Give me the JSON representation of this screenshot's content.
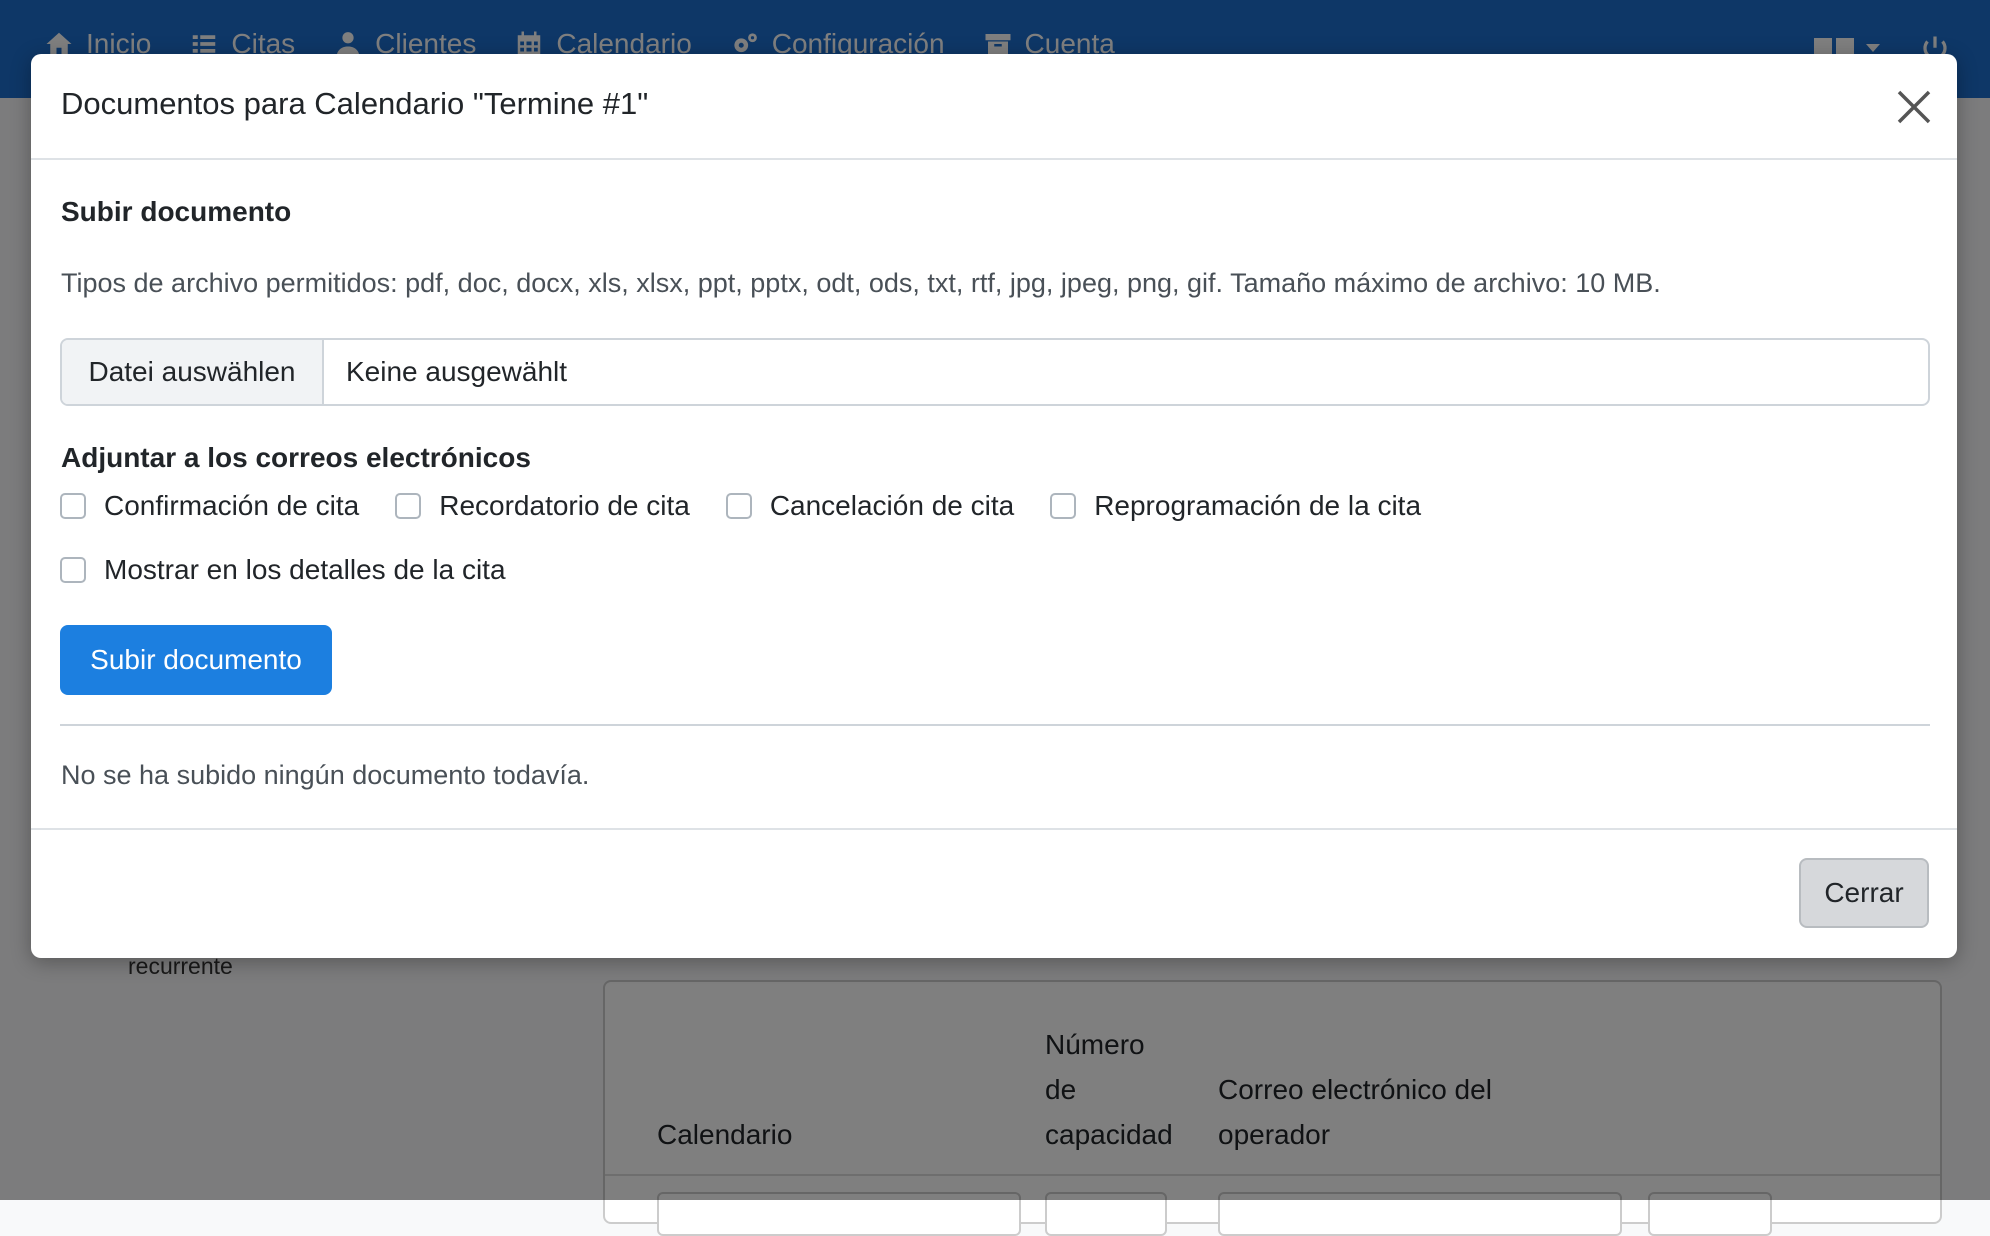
{
  "nav": {
    "items": [
      {
        "label": "Inicio",
        "icon": "home-icon"
      },
      {
        "label": "Citas",
        "icon": "list-icon"
      },
      {
        "label": "Clientes",
        "icon": "user-icon"
      },
      {
        "label": "Calendario",
        "icon": "calendar-icon"
      },
      {
        "label": "Configuración",
        "icon": "cogs-icon"
      },
      {
        "label": "Cuenta",
        "icon": "archive-icon"
      }
    ],
    "color": "#1c6fcf"
  },
  "background": {
    "sidebar_text": "recurrente",
    "table_headers": {
      "calendar": "Calendario",
      "capacity_1": "Número",
      "capacity_2": "de",
      "capacity_3": "capacidad",
      "operator_1": "Correo electrónico del",
      "operator_2": "operador"
    }
  },
  "modal": {
    "title": "Documentos para Calendario \"Termine #1\"",
    "upload_heading": "Subir documento",
    "allowed_types_text": "Tipos de archivo permitidos: pdf, doc, docx, xls, xlsx, ppt, pptx, odt, ods, txt, rtf, jpg, jpeg, png, gif. Tamaño máximo de archivo: 10 MB.",
    "file_input": {
      "button_label": "Datei auswählen",
      "status": "Keine ausgewählt"
    },
    "attach_heading": "Adjuntar a los correos electrónicos",
    "checkboxes": [
      {
        "label": "Confirmación de cita",
        "checked": false
      },
      {
        "label": "Recordatorio de cita",
        "checked": false
      },
      {
        "label": "Cancelación de cita",
        "checked": false
      },
      {
        "label": "Reprogramación de la cita",
        "checked": false
      }
    ],
    "details_checkbox": {
      "label": "Mostrar en los detalles de la cita",
      "checked": false
    },
    "upload_button_label": "Subir documento",
    "empty_message": "No se ha subido ningún documento todavía.",
    "close_button_label": "Cerrar",
    "primary_color": "#1c7fe0"
  }
}
